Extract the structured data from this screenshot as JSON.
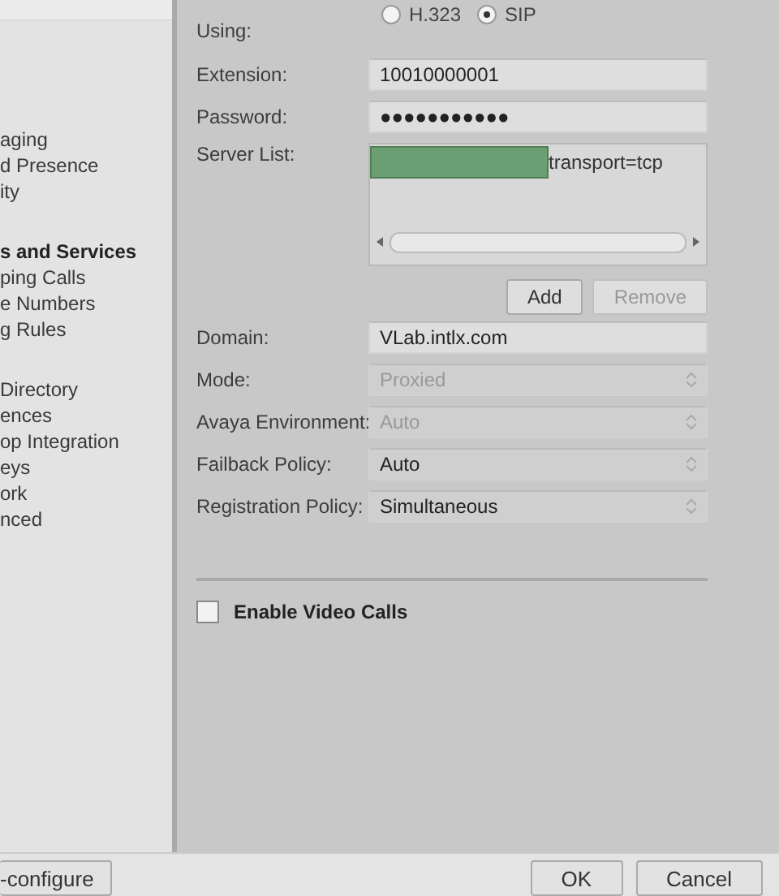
{
  "sidebar": {
    "groups": [
      {
        "items": [
          {
            "label": "aging",
            "bold": false
          },
          {
            "label": "d Presence",
            "bold": false
          },
          {
            "label": "ity",
            "bold": false
          }
        ]
      },
      {
        "items": [
          {
            "label": "s and Services",
            "bold": true
          },
          {
            "label": "ping Calls",
            "bold": false
          },
          {
            "label": "e Numbers",
            "bold": false
          },
          {
            "label": "g Rules",
            "bold": false
          }
        ]
      },
      {
        "items": [
          {
            "label": "Directory",
            "bold": false
          },
          {
            "label": "ences",
            "bold": false
          },
          {
            "label": "op Integration",
            "bold": false
          },
          {
            "label": "eys",
            "bold": false
          },
          {
            "label": "ork",
            "bold": false
          },
          {
            "label": "nced",
            "bold": false
          }
        ]
      }
    ]
  },
  "using": {
    "label": "Using:",
    "options": [
      {
        "label": "H.323",
        "selected": false
      },
      {
        "label": "SIP",
        "selected": true
      }
    ]
  },
  "fields": [
    {
      "label": "Extension:",
      "value": "10010000001"
    },
    {
      "label": "Password:",
      "value": "●●●●●●●●●●●"
    }
  ],
  "server_list": {
    "label": "Server List:",
    "entries": [
      "transport=tcp"
    ],
    "buttons": [
      {
        "label": "Add",
        "disabled": false
      },
      {
        "label": "Remove",
        "disabled": true
      }
    ]
  },
  "settings": [
    {
      "kind": "text",
      "label": "Domain:",
      "value": "VLab.intlx.com",
      "disabled": false
    },
    {
      "kind": "select",
      "label": "Mode:",
      "value": "Proxied",
      "disabled": true
    },
    {
      "kind": "select",
      "label": "Avaya Environment:",
      "value": "Auto",
      "disabled": true
    },
    {
      "kind": "select",
      "label": "Failback Policy:",
      "value": "Auto",
      "disabled": false
    },
    {
      "kind": "select",
      "label": "Registration Policy:",
      "value": "Simultaneous",
      "disabled": false
    }
  ],
  "video": {
    "label": "Enable Video Calls",
    "checked": false
  },
  "footer": {
    "left_button": "-configure",
    "buttons": [
      "OK",
      "Cancel"
    ]
  }
}
